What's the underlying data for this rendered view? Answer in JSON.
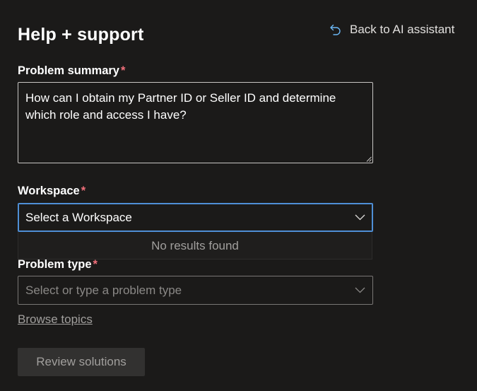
{
  "header": {
    "title": "Help + support",
    "back_label": "Back to AI assistant"
  },
  "problem_summary": {
    "label": "Problem summary",
    "required_mark": "*",
    "value": "How can I obtain my Partner ID or Seller ID and determine which role and access I have?"
  },
  "workspace": {
    "label": "Workspace",
    "required_mark": "*",
    "placeholder": "Select a Workspace",
    "popup_message": "No results found"
  },
  "problem_type": {
    "label": "Problem type",
    "required_mark": "*",
    "placeholder": "Select or type a problem type"
  },
  "links": {
    "browse_topics": "Browse topics"
  },
  "actions": {
    "review_label": "Review solutions"
  },
  "icons": {
    "back": "undo-arrow-icon",
    "chevron": "chevron-down-icon"
  },
  "colors": {
    "background": "#1b1a19",
    "focus_border": "#4f8fd6",
    "required": "#f1707b",
    "muted_text": "#a19f9d"
  }
}
